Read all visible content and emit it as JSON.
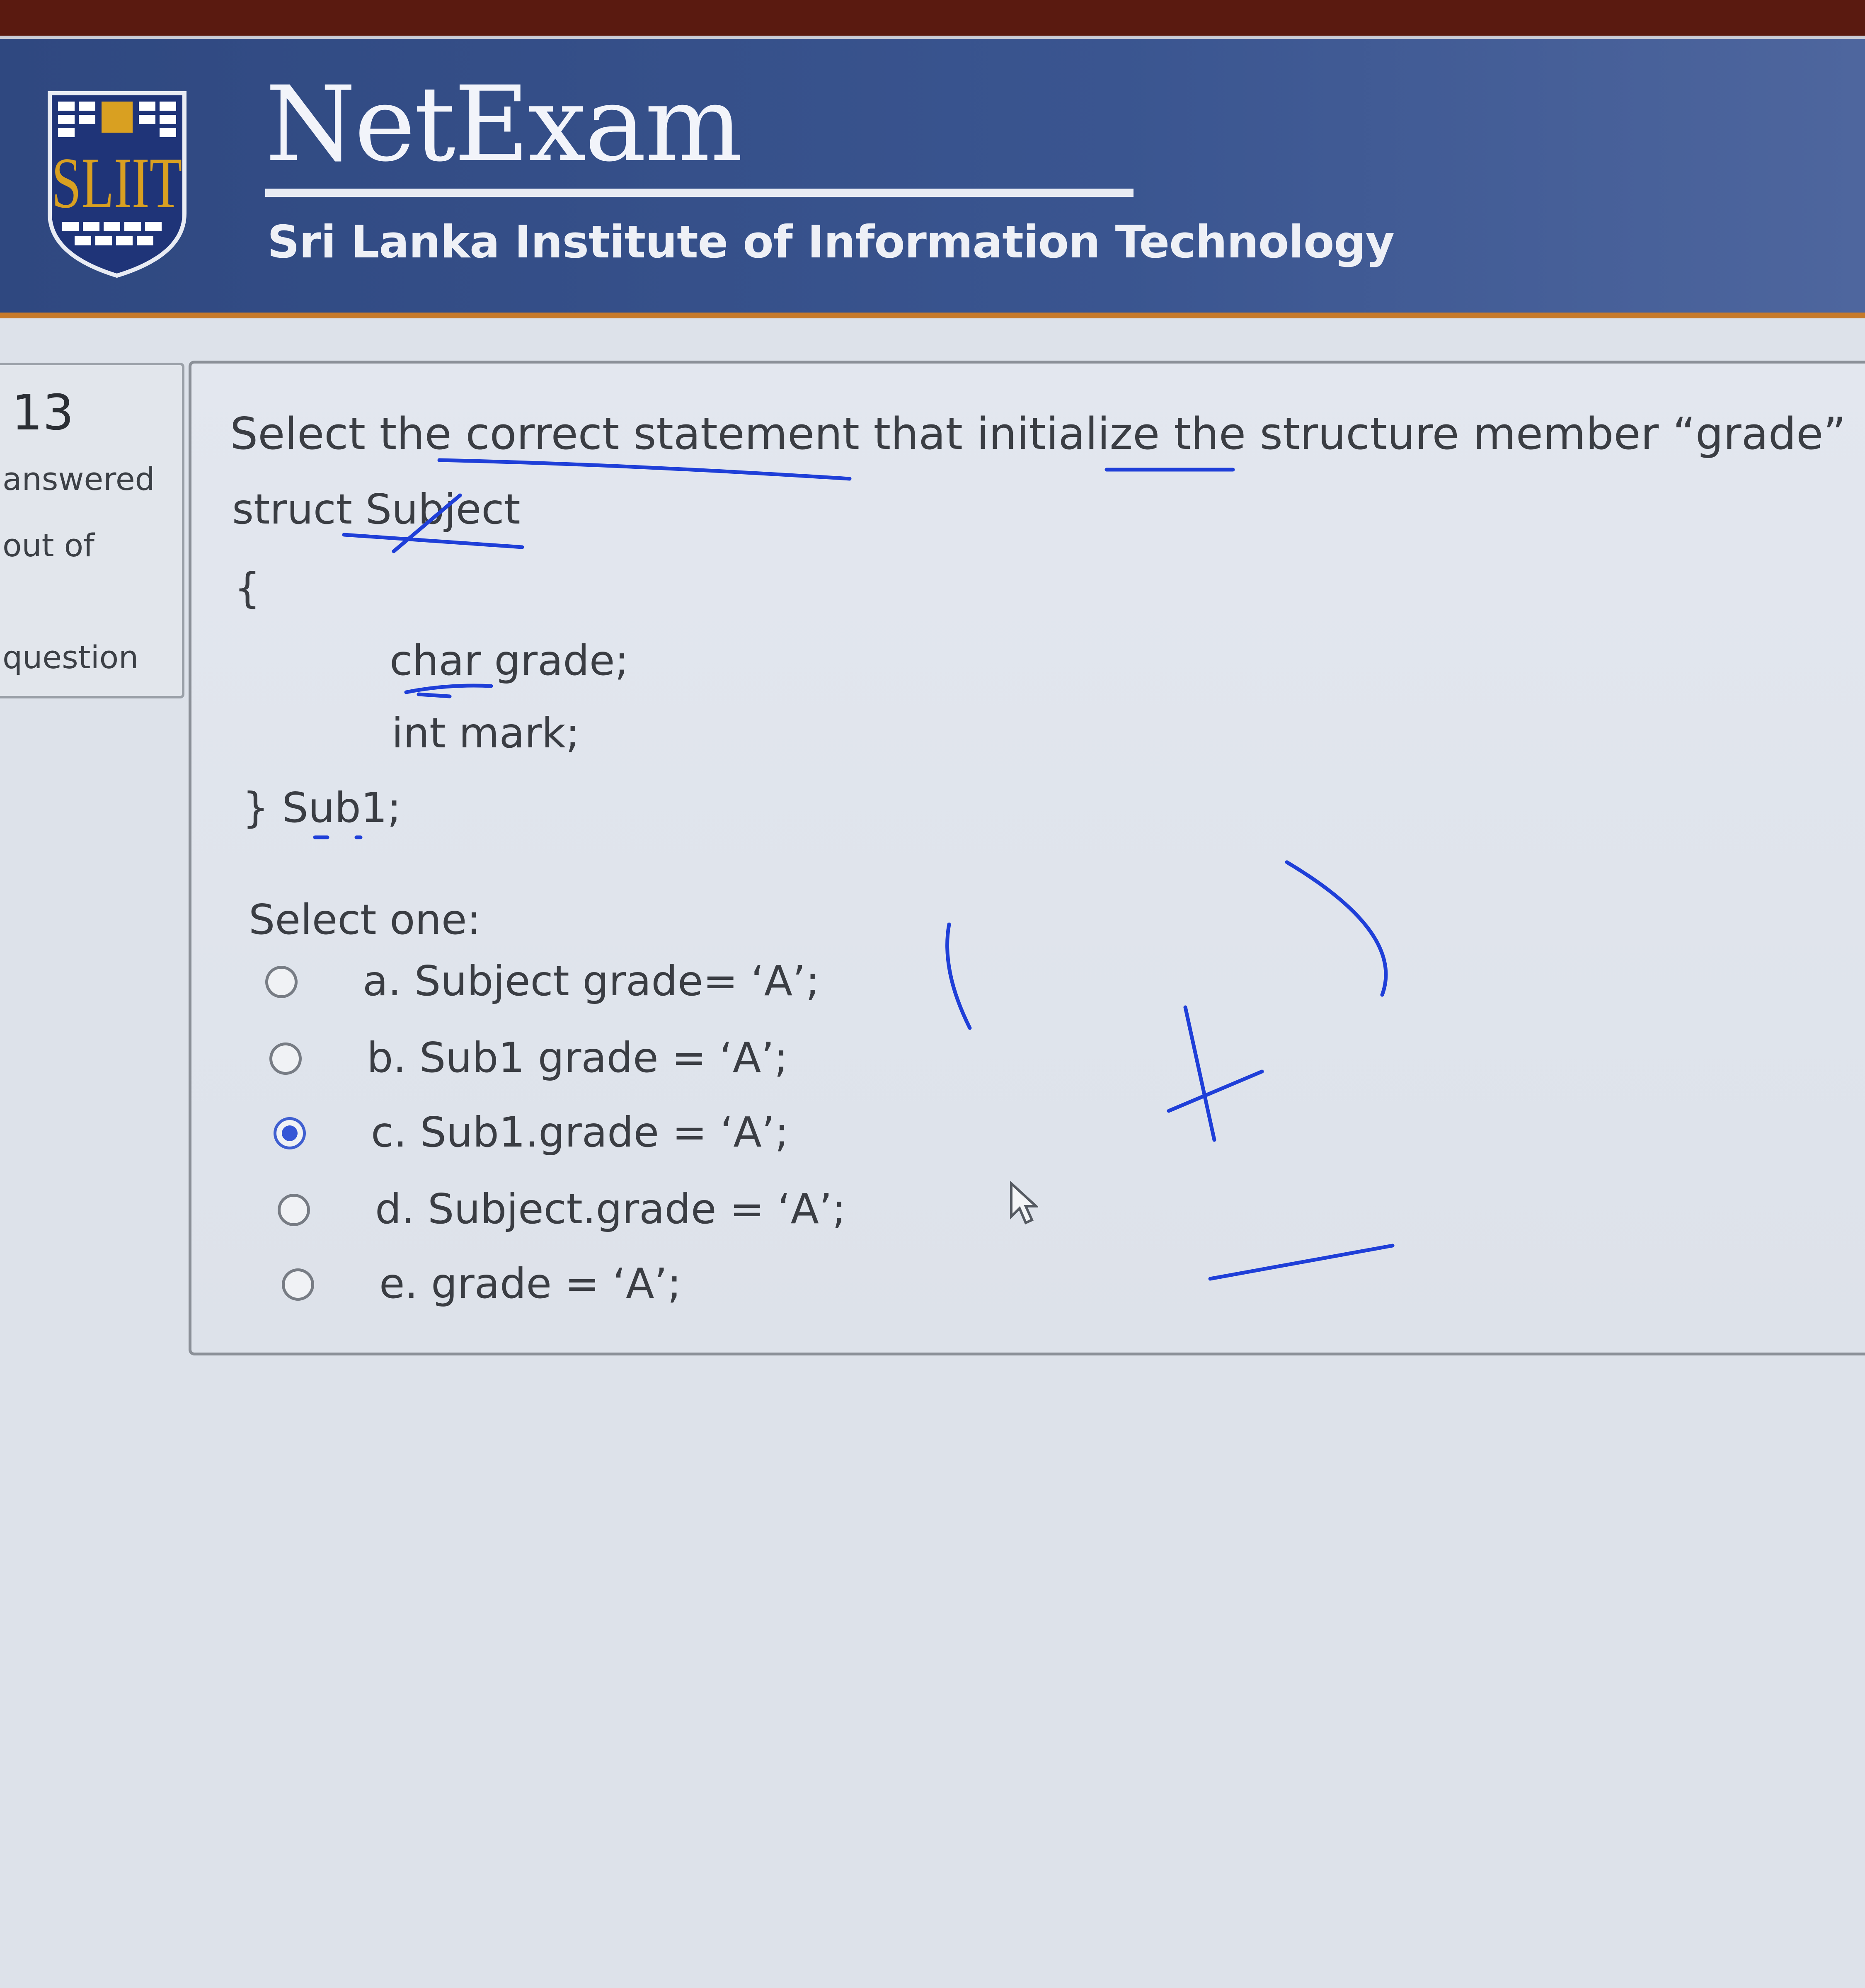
{
  "header": {
    "brand_title": "NetExam",
    "institute_name": "Sri Lanka Institute of Information Technology",
    "logo_text": "SLIIT"
  },
  "sidebar": {
    "question_number": "13",
    "line_answered": "answered",
    "line_out_of": "out of",
    "line_question": "question"
  },
  "question": {
    "prompt": "Select the correct statement that initialize the structure member “grade”",
    "code_lines": [
      "struct Subject",
      "{",
      "char grade;",
      "int mark;",
      "} Sub1;"
    ],
    "select_label": "Select one:",
    "options": [
      {
        "label": "a. Subject grade= ‘A’;",
        "checked": false
      },
      {
        "label": "b. Sub1 grade = ‘A’;",
        "checked": false
      },
      {
        "label": "c. Sub1.grade = ‘A’;",
        "checked": true
      },
      {
        "label": "d. Subject.grade = ‘A’;",
        "checked": false
      },
      {
        "label": "e. grade = ‘A’;",
        "checked": false
      }
    ]
  },
  "colors": {
    "header_blue": "#34508a",
    "accent_orange": "#c77a2a",
    "radio_selected": "#3556d6",
    "pen_ink": "#1f3fd8"
  },
  "icons": [
    "sliit-logo",
    "mouse-cursor-icon"
  ]
}
